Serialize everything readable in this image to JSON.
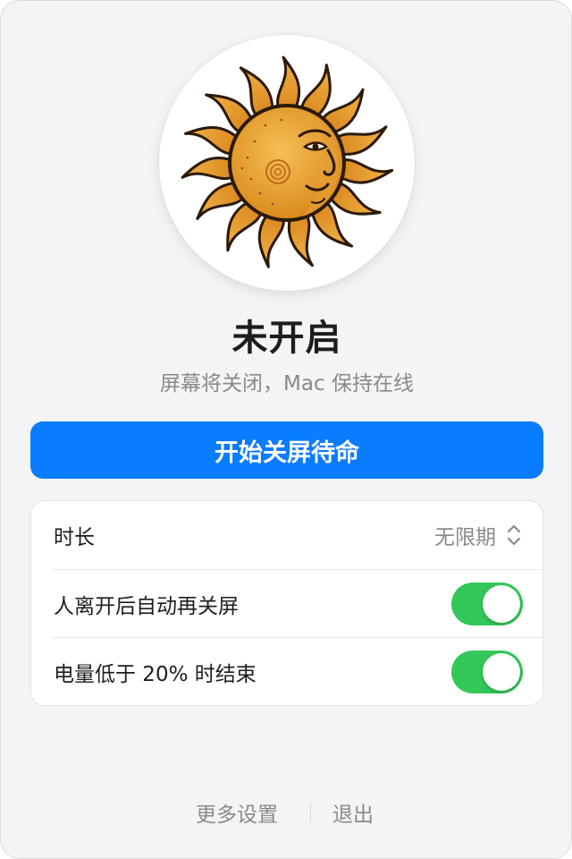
{
  "status": {
    "title": "未开启",
    "subtitle": "屏幕将关闭，Mac 保持在线",
    "avatar_icon": "sun-face-icon"
  },
  "primary_action": {
    "label": "开始关屏待命",
    "color": "#0a7cff"
  },
  "settings": {
    "duration": {
      "label": "时长",
      "value": "无限期",
      "icon": "chevron-updown-icon"
    },
    "auto_lock_on_leave": {
      "label": "人离开后自动再关屏",
      "enabled": true
    },
    "end_on_low_battery": {
      "label": "电量低于 20% 时结束",
      "enabled": true
    },
    "toggle_on_color": "#34c759"
  },
  "footer": {
    "more_settings": "更多设置",
    "quit": "退出"
  }
}
